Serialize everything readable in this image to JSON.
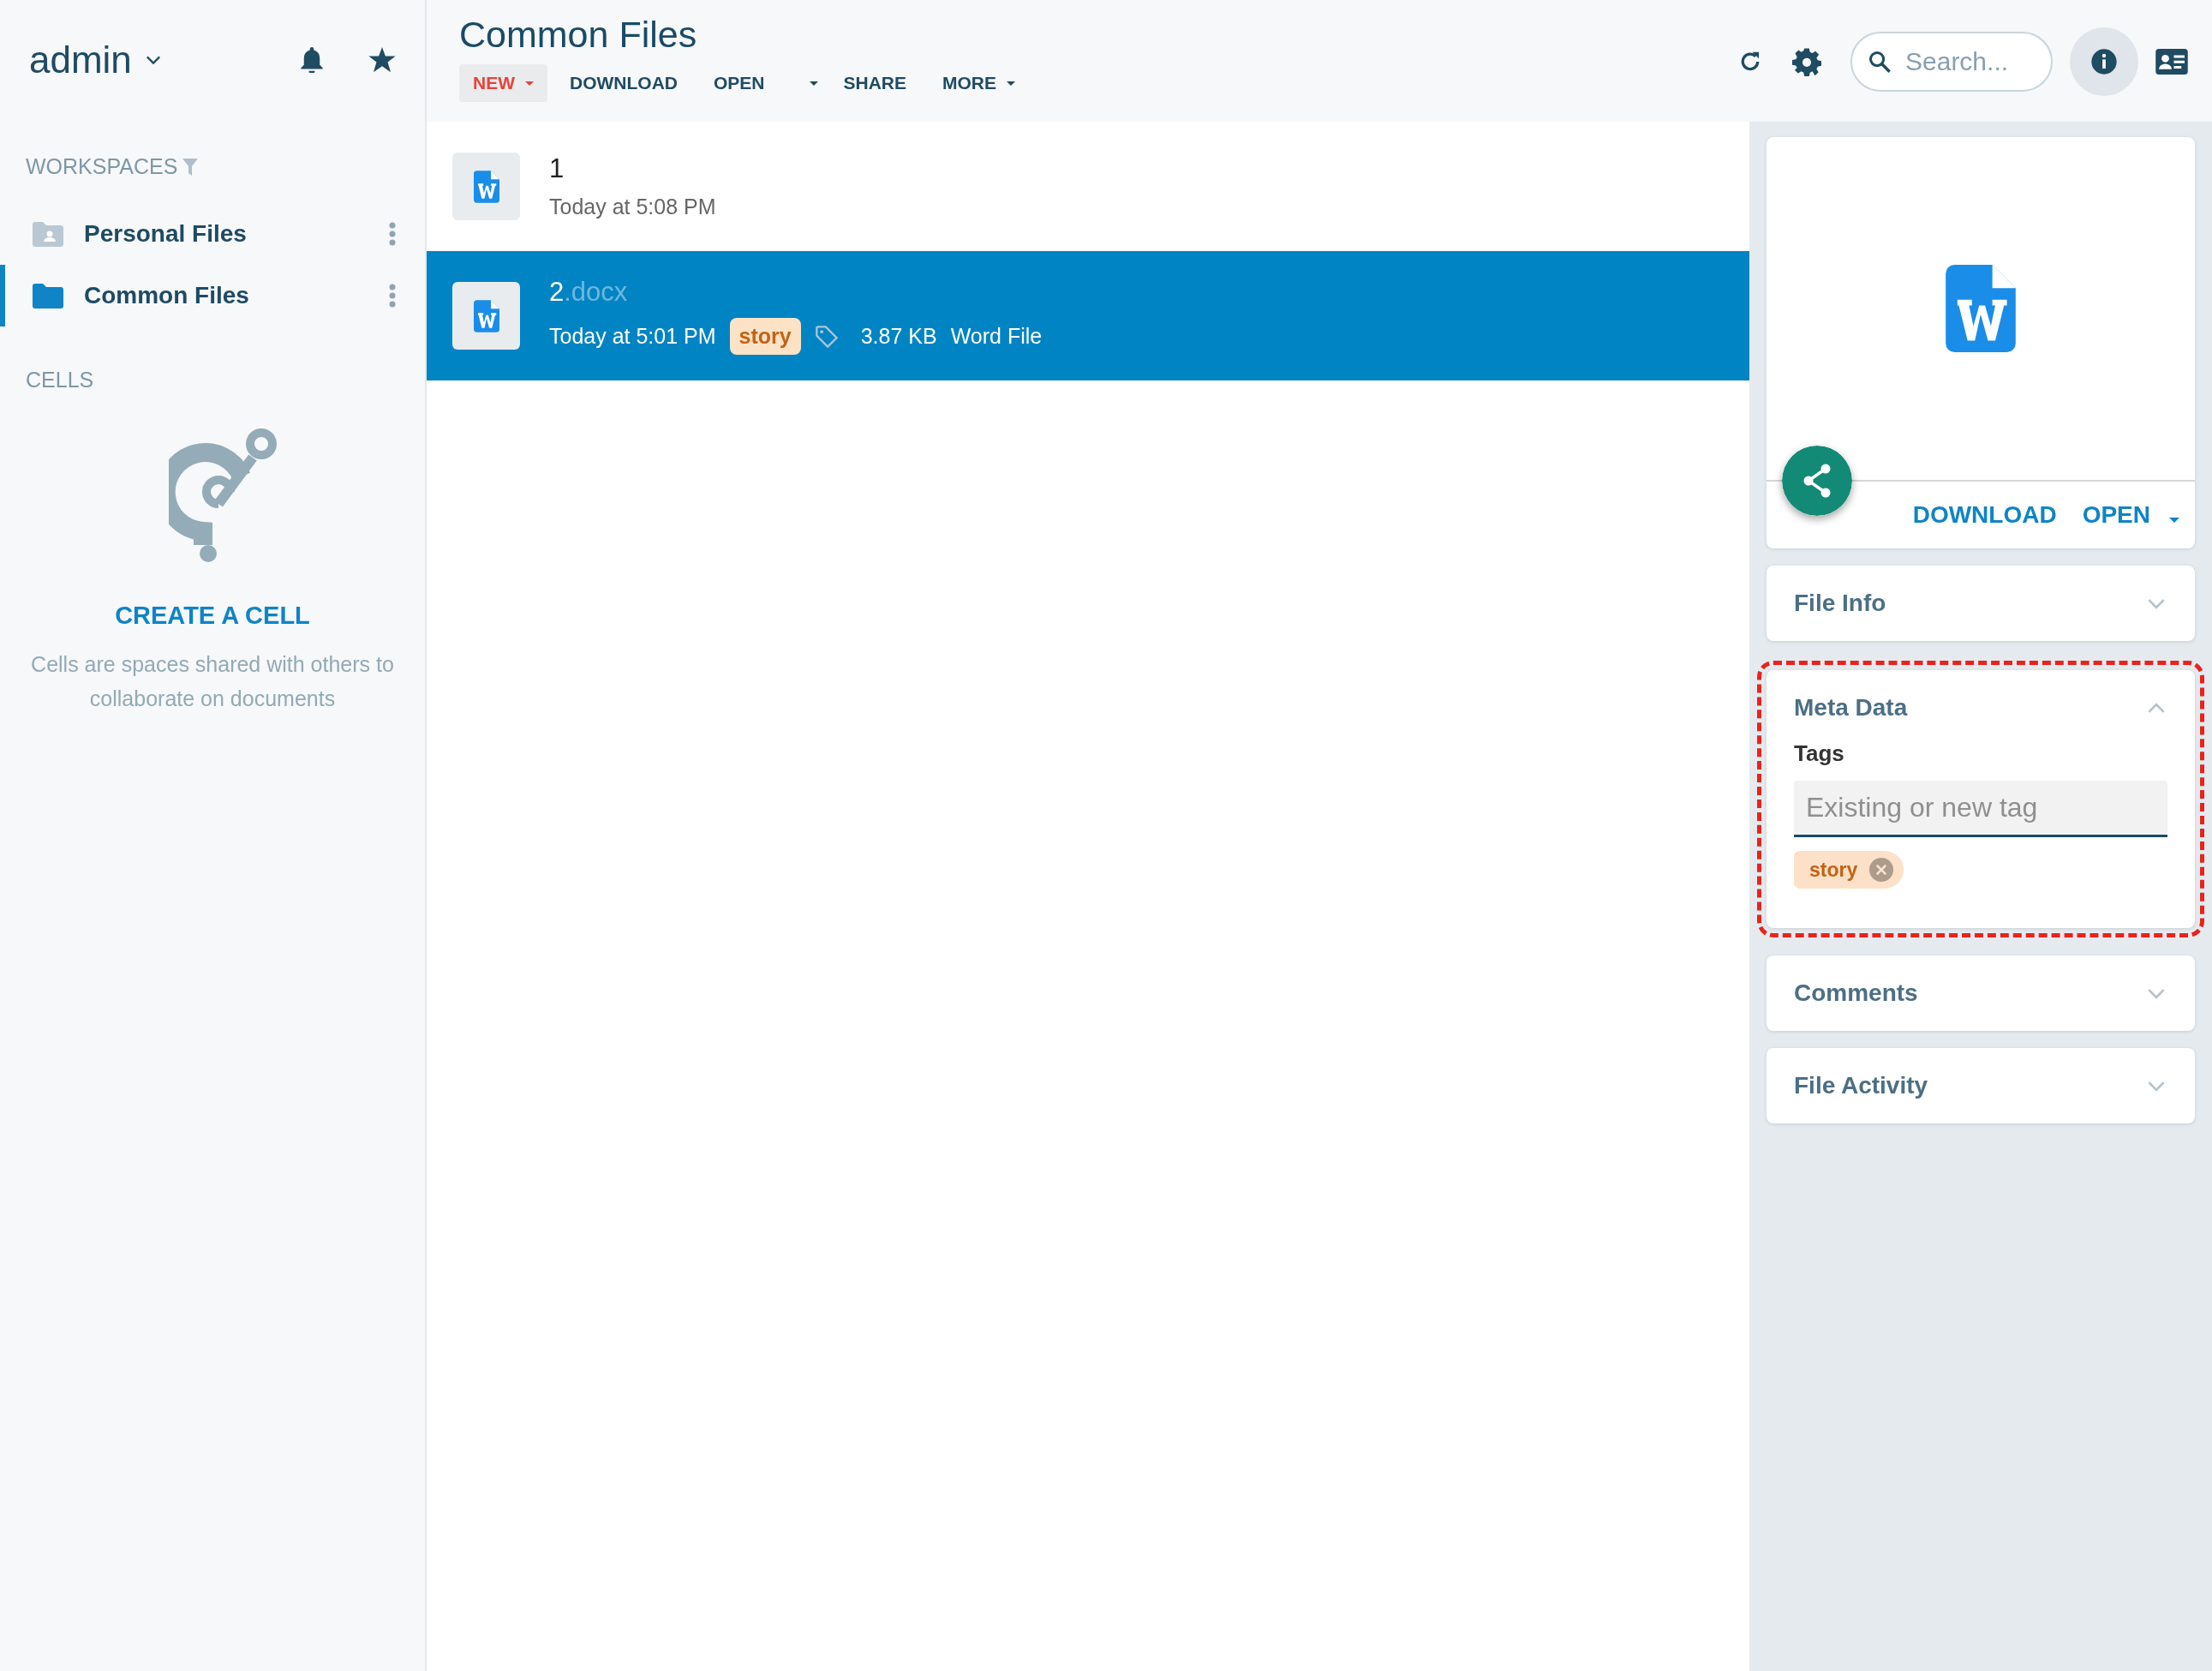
{
  "sidebar": {
    "user": "admin",
    "workspaces_label": "WORKSPACES",
    "workspaces": [
      {
        "label": "Personal Files",
        "kind": "personal",
        "selected": false
      },
      {
        "label": "Common Files",
        "kind": "folder",
        "selected": true
      }
    ],
    "cells_label": "CELLS",
    "create_cell": "CREATE A CELL",
    "cells_hint": "Cells are spaces shared with others to collaborate on documents"
  },
  "header": {
    "title": "Common Files",
    "toolbar": [
      {
        "label": "NEW",
        "kind": "primary",
        "dropdown": true
      },
      {
        "label": "DOWNLOAD",
        "kind": "plain",
        "dropdown": false
      },
      {
        "label": "OPEN",
        "kind": "split",
        "dropdown": true
      },
      {
        "label": "SHARE",
        "kind": "plain",
        "dropdown": false
      },
      {
        "label": "MORE",
        "kind": "plain",
        "dropdown": true
      }
    ],
    "search": {
      "placeholder": "Search..."
    },
    "info_selected": true
  },
  "files": [
    {
      "name": "1",
      "date": "Today at 5:08 PM",
      "selected": false
    },
    {
      "name": "2",
      "extension": ".docx",
      "date": "Today at 5:01 PM",
      "tags": [
        "story"
      ],
      "size": "3.87 KB",
      "type": "Word File",
      "selected": true
    }
  ],
  "details": {
    "actions": [
      {
        "label": "DOWNLOAD",
        "caret": false
      },
      {
        "label": "OPEN",
        "caret": true
      }
    ],
    "panels": [
      {
        "title": "File Info",
        "expanded": false,
        "highlighted": false
      },
      {
        "title": "Meta Data",
        "expanded": true,
        "highlighted": true,
        "tags_label": "Tags",
        "tag_input": {
          "placeholder": "Existing or new tag"
        },
        "tags": [
          "story"
        ]
      },
      {
        "title": "Comments",
        "expanded": false,
        "highlighted": false
      },
      {
        "title": "File Activity",
        "expanded": false,
        "highlighted": false
      }
    ]
  }
}
